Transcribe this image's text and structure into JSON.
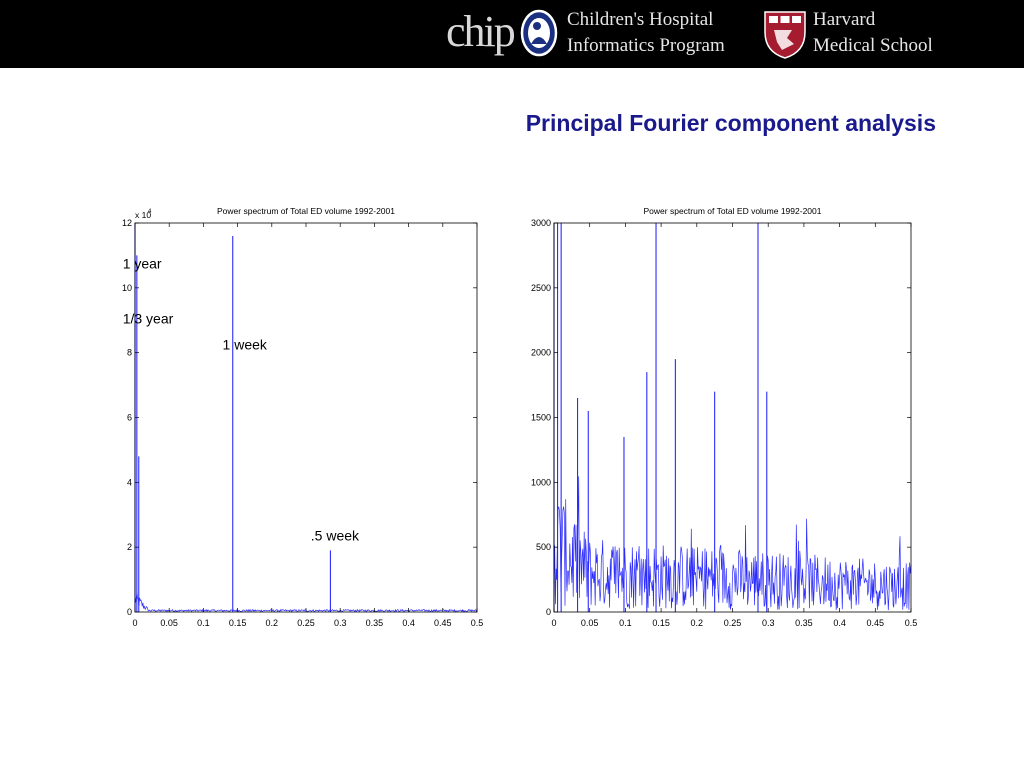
{
  "header": {
    "logo_text": "chip",
    "org_line1": "Children's Hospital",
    "org_line2": "Informatics Program",
    "school_line1": "Harvard",
    "school_line2": "Medical School",
    "shield_text": "VE RI TAS"
  },
  "slide": {
    "title": "Principal Fourier component analysis"
  },
  "chart_data": [
    {
      "type": "line",
      "title": "Power spectrum of Total ED volume 1992-2001",
      "xlim": [
        0,
        0.5
      ],
      "ylim": [
        0,
        120000
      ],
      "y_exponent_label": "x 10",
      "y_exponent_power": "4",
      "xticks": [
        "0",
        "0.05",
        "0.1",
        "0.15",
        "0.2",
        "0.25",
        "0.3",
        "0.35",
        "0.4",
        "0.45",
        "0.5"
      ],
      "yticks": [
        "0",
        "2",
        "4",
        "6",
        "8",
        "10",
        "12"
      ],
      "series_color": "#2b2bff",
      "peaks": [
        {
          "x": 0.0,
          "y": 120000
        },
        {
          "x": 0.0027,
          "y": 110000
        },
        {
          "x": 0.0055,
          "y": 48000
        },
        {
          "x": 0.1429,
          "y": 116000
        },
        {
          "x": 0.2857,
          "y": 19000
        }
      ],
      "annotations": [
        {
          "text": "1 year",
          "x": -0.018,
          "y": 106000
        },
        {
          "text": "1/3 year",
          "x": -0.018,
          "y": 89000
        },
        {
          "text": "1 week",
          "x": 0.128,
          "y": 81000
        },
        {
          "text": ".5 week",
          "x": 0.257,
          "y": 22000
        }
      ]
    },
    {
      "type": "line",
      "title": "Power spectrum of Total ED volume 1992-2001",
      "xlim": [
        0,
        0.5
      ],
      "ylim": [
        0,
        3000
      ],
      "xticks": [
        "0",
        "0.05",
        "0.1",
        "0.15",
        "0.2",
        "0.25",
        "0.3",
        "0.35",
        "0.4",
        "0.45",
        "0.5"
      ],
      "yticks": [
        "0",
        "500",
        "1000",
        "1500",
        "2000",
        "2500",
        "3000"
      ],
      "series_color": "#2b2bff",
      "peaks": [
        {
          "x": 0.0,
          "y": 3000
        },
        {
          "x": 0.005,
          "y": 3000
        },
        {
          "x": 0.01,
          "y": 3000
        },
        {
          "x": 0.033,
          "y": 1650
        },
        {
          "x": 0.048,
          "y": 1550
        },
        {
          "x": 0.098,
          "y": 1350
        },
        {
          "x": 0.13,
          "y": 1850
        },
        {
          "x": 0.1429,
          "y": 3000
        },
        {
          "x": 0.17,
          "y": 1950
        },
        {
          "x": 0.225,
          "y": 1700
        },
        {
          "x": 0.2857,
          "y": 3000
        },
        {
          "x": 0.298,
          "y": 1700
        }
      ]
    }
  ]
}
